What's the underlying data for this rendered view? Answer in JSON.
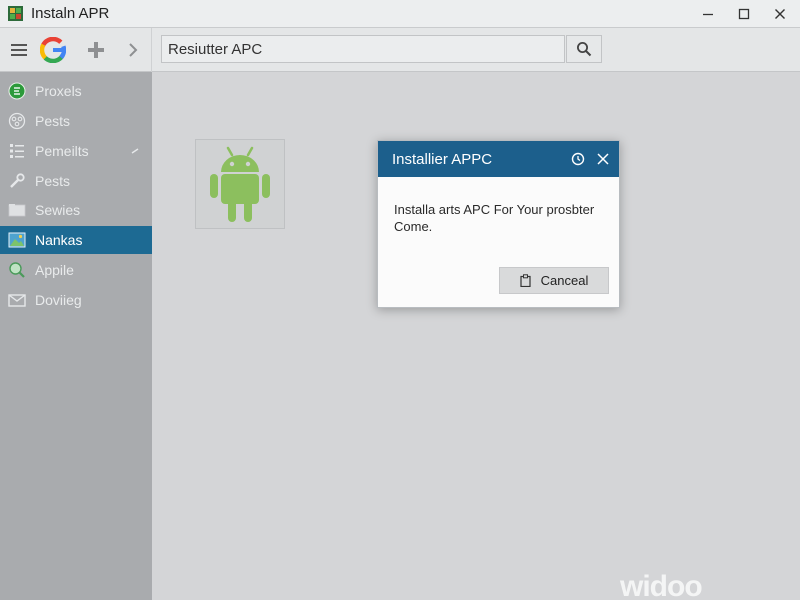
{
  "window": {
    "title": "Instaln APR"
  },
  "toolbar": {
    "search_value": "Resiutter APC"
  },
  "sidebar": {
    "items": [
      {
        "label": "Proxels",
        "icon": "green-circle-icon"
      },
      {
        "label": "Pests",
        "icon": "network-icon"
      },
      {
        "label": "Pemeilts",
        "icon": "list-icon"
      },
      {
        "label": "Pests",
        "icon": "wrench-icon"
      },
      {
        "label": "Sewies",
        "icon": "folder-icon"
      },
      {
        "label": "Nankas",
        "icon": "image-icon"
      },
      {
        "label": "Appile",
        "icon": "magnifier-icon"
      },
      {
        "label": "Doviieg",
        "icon": "mail-icon"
      }
    ],
    "active_index": 5
  },
  "dialog": {
    "title": "Installier APPC",
    "message": "Installa arts APC For Your prosbter Come.",
    "cancel_label": "Canceal"
  },
  "watermark": "widoo",
  "colors": {
    "accent": "#1d6a93",
    "dialog_header": "#1c5f8c",
    "android_green": "#8cbf5e",
    "sidebar_bg": "#a9abae"
  }
}
